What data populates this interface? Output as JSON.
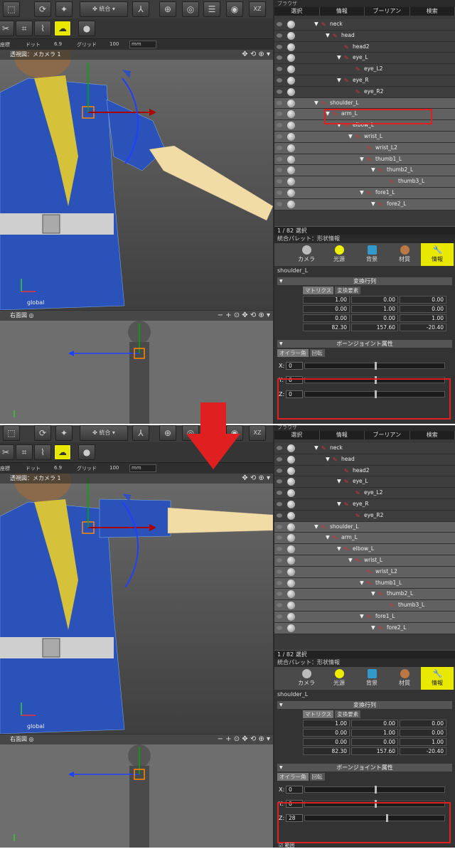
{
  "toolbar": {
    "mode_label": "統合",
    "coord_label": "座標",
    "dot_label": "ドット",
    "dot_value": "6.9",
    "grid_label": "グリッド",
    "grid_value": "100",
    "unit": "mm"
  },
  "viewport_main": {
    "title": "透視図：メカメラ 1",
    "axis_label": "global"
  },
  "viewport_right": {
    "title": "右面図"
  },
  "browser": {
    "header": "ブラウザ",
    "tabs": [
      "選択",
      "情報",
      "ブーリアン",
      "検索"
    ],
    "rows": [
      {
        "name": "neck",
        "indent": 60,
        "bone": true,
        "tri": true
      },
      {
        "name": "head",
        "indent": 76,
        "bone": true,
        "tri": true
      },
      {
        "name": "head2",
        "indent": 92,
        "bone": true,
        "tri": false
      },
      {
        "name": "eye_L",
        "indent": 92,
        "bone": true,
        "tri": true
      },
      {
        "name": "eye_L2",
        "indent": 108,
        "bone": true,
        "tri": false
      },
      {
        "name": "eye_R",
        "indent": 92,
        "bone": true,
        "tri": true
      },
      {
        "name": "eye_R2",
        "indent": 108,
        "bone": true,
        "tri": false
      },
      {
        "name": "shoulder_L",
        "indent": 60,
        "bone": true,
        "tri": true,
        "sel": true
      },
      {
        "name": "arm_L",
        "indent": 76,
        "bone": true,
        "tri": true,
        "sel": true
      },
      {
        "name": "elbow_L",
        "indent": 92,
        "bone": true,
        "tri": true,
        "sel": true
      },
      {
        "name": "wrist_L",
        "indent": 108,
        "bone": true,
        "tri": true,
        "sel": true
      },
      {
        "name": "wrist_L2",
        "indent": 124,
        "bone": true,
        "tri": false,
        "sel": true
      },
      {
        "name": "thumb1_L",
        "indent": 124,
        "bone": true,
        "tri": true,
        "sel": true
      },
      {
        "name": "thumb2_L",
        "indent": 140,
        "bone": true,
        "tri": true,
        "sel": true
      },
      {
        "name": "thumb3_L",
        "indent": 156,
        "bone": true,
        "tri": false,
        "sel": true
      },
      {
        "name": "fore1_L",
        "indent": 124,
        "bone": true,
        "tri": true,
        "sel": true
      },
      {
        "name": "fore2_L",
        "indent": 140,
        "bone": true,
        "tri": true,
        "sel": true
      }
    ],
    "count": "1 / 82 選択"
  },
  "palette": {
    "title": "統合パレット：形状情報",
    "icons": [
      "カメラ",
      "光源",
      "背景",
      "材質",
      "情報"
    ],
    "object_name": "shoulder_L",
    "section_matrix": "変換行列",
    "subtab_matrix": "マトリクス",
    "subtab_elements": "変換要素",
    "matrix": [
      [
        "1.00",
        "0.00",
        "0.00"
      ],
      [
        "0.00",
        "1.00",
        "0.00"
      ],
      [
        "0.00",
        "0.00",
        "1.00"
      ],
      [
        "82.30",
        "157.60",
        "-20.40"
      ]
    ],
    "section_bone": "ボーンジョイント属性",
    "subtab_euler": "オイラー角",
    "subtab_rot": "回転"
  },
  "before": {
    "x": "0",
    "y": "0",
    "z": "0",
    "zpct": 0.5
  },
  "after": {
    "x": "0",
    "y": "0",
    "z": "28",
    "zpct": 0.58
  },
  "footer_check": "範囲"
}
